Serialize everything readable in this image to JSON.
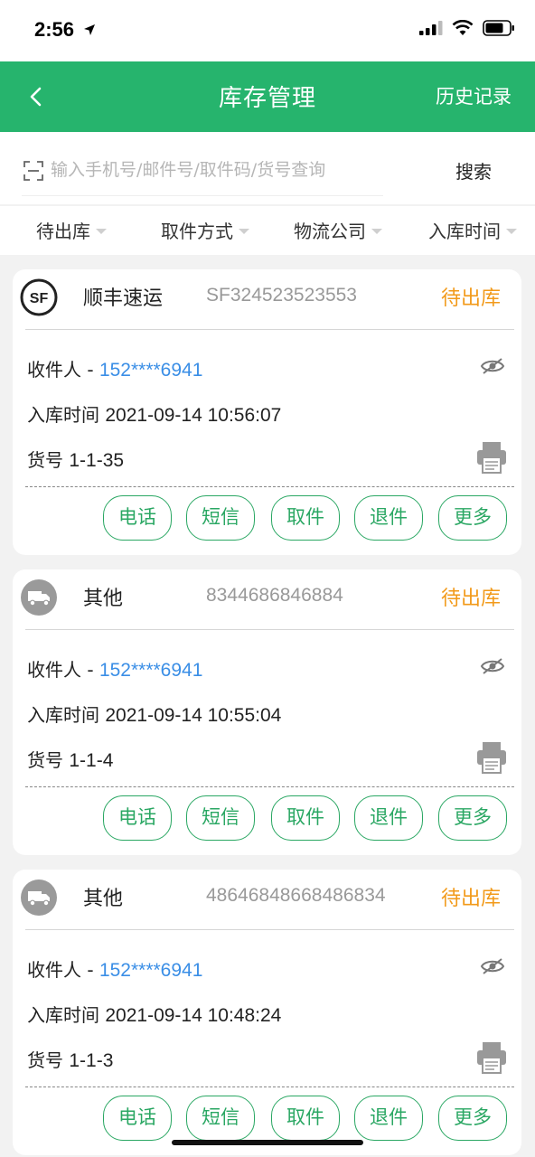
{
  "status_bar": {
    "time": "2:56"
  },
  "header": {
    "title": "库存管理",
    "history_label": "历史记录"
  },
  "search": {
    "placeholder": "输入手机号/邮件号/取件码/货号查询",
    "button_label": "搜索"
  },
  "filters": [
    "待出库",
    "取件方式",
    "物流公司",
    "入库时间"
  ],
  "parcels": [
    {
      "company": "顺丰速运",
      "logo": "sf-express-logo",
      "tracking": "SF324523523553",
      "status": "待出库",
      "recipient_label": "收件人 - ",
      "recipient_phone": "152****6941",
      "inbound_label": "入库时间 ",
      "inbound_time": "2021-09-14 10:56:07",
      "shelf_label": "货号 ",
      "shelf_no": "1-1-35",
      "actions": [
        "电话",
        "短信",
        "取件",
        "退件",
        "更多"
      ]
    },
    {
      "company": "其他",
      "logo": "truck-icon",
      "tracking": "8344686846884",
      "status": "待出库",
      "recipient_label": "收件人 - ",
      "recipient_phone": "152****6941",
      "inbound_label": "入库时间 ",
      "inbound_time": "2021-09-14 10:55:04",
      "shelf_label": "货号 ",
      "shelf_no": "1-1-4",
      "actions": [
        "电话",
        "短信",
        "取件",
        "退件",
        "更多"
      ]
    },
    {
      "company": "其他",
      "logo": "truck-icon",
      "tracking": "48646848668486834",
      "status": "待出库",
      "recipient_label": "收件人 - ",
      "recipient_phone": "152****6941",
      "inbound_label": "入库时间 ",
      "inbound_time": "2021-09-14 10:48:24",
      "shelf_label": "货号 ",
      "shelf_no": "1-1-3",
      "actions": [
        "电话",
        "短信",
        "取件",
        "退件",
        "更多"
      ]
    }
  ],
  "colors": {
    "header": "#26b46d",
    "status": "#f29a1a",
    "phone": "#3a8ee6",
    "button": "#2aa763"
  }
}
